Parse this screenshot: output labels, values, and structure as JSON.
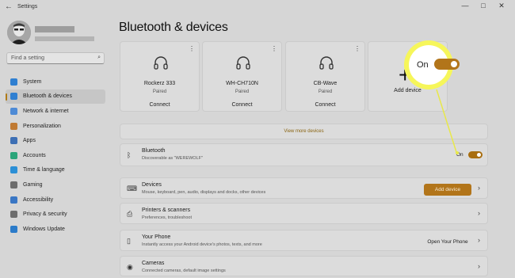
{
  "window": {
    "title": "Settings",
    "back_glyph": "←",
    "min_glyph": "—",
    "max_glyph": "□",
    "close_glyph": "✕"
  },
  "search": {
    "placeholder": "Find a setting"
  },
  "sidebar": {
    "items": [
      {
        "label": "System",
        "icon": "system-icon",
        "color": "#2f7fd1"
      },
      {
        "label": "Bluetooth & devices",
        "icon": "bluetooth-devices-icon",
        "color": "#2f7fd1",
        "active": true
      },
      {
        "label": "Network & internet",
        "icon": "network-icon",
        "color": "#4e8bd6"
      },
      {
        "label": "Personalization",
        "icon": "personalization-icon",
        "color": "#c07a33"
      },
      {
        "label": "Apps",
        "icon": "apps-icon",
        "color": "#3d6fb4"
      },
      {
        "label": "Accounts",
        "icon": "accounts-icon",
        "color": "#2aa57a"
      },
      {
        "label": "Time & language",
        "icon": "time-language-icon",
        "color": "#2b8fd6"
      },
      {
        "label": "Gaming",
        "icon": "gaming-icon",
        "color": "#6c6c6c"
      },
      {
        "label": "Accessibility",
        "icon": "accessibility-icon",
        "color": "#3976c4"
      },
      {
        "label": "Privacy & security",
        "icon": "privacy-icon",
        "color": "#6d6d6d"
      },
      {
        "label": "Windows Update",
        "icon": "windows-update-icon",
        "color": "#2b7bc9"
      }
    ]
  },
  "page": {
    "title": "Bluetooth & devices"
  },
  "devices": [
    {
      "name": "Rockerz 333",
      "status": "Paired",
      "action": "Connect"
    },
    {
      "name": "WH-CH710N",
      "status": "Paired",
      "action": "Connect"
    },
    {
      "name": "CB-Wave",
      "status": "Paired",
      "action": "Connect"
    }
  ],
  "add_card": {
    "label": "Add device",
    "plus": "+"
  },
  "view_more": "View more devices",
  "bluetooth_row": {
    "title": "Bluetooth",
    "subtitle": "Discoverable as \"WEREWOLF\"",
    "state": "On",
    "toggle_on": true
  },
  "rows": [
    {
      "title": "Devices",
      "subtitle": "Mouse, keyboard, pen, audio, displays and docks, other devices",
      "button": "Add device",
      "icon": "devices-icon"
    },
    {
      "title": "Printers & scanners",
      "subtitle": "Preferences, troubleshoot",
      "icon": "printer-icon"
    },
    {
      "title": "Your Phone",
      "subtitle": "Instantly access your Android device's photos, texts, and more",
      "button": "Open Your Phone",
      "icon": "phone-icon"
    },
    {
      "title": "Cameras",
      "subtitle": "Connected cameras, default image settings",
      "icon": "camera-icon"
    }
  ],
  "callout": {
    "label": "On",
    "color": "#f6f65a"
  },
  "accent_color": "#b2751a"
}
